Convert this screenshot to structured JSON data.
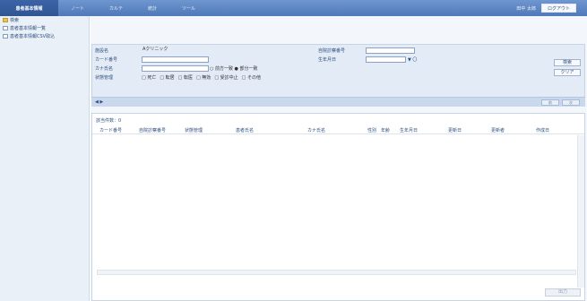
{
  "nav": {
    "tabs": [
      "患者基本情報",
      "ノート",
      "カルテ",
      "統計",
      "ツール"
    ],
    "user": "田中 太郎",
    "logout": "ログアウト"
  },
  "sidebar": {
    "items": [
      {
        "label": "検索",
        "icon": "folder-icon"
      },
      {
        "label": "患者基本情報一覧",
        "icon": "doc-icon"
      },
      {
        "label": "患者基本情報CSV取込",
        "icon": "doc-icon"
      }
    ]
  },
  "search": {
    "labels": {
      "clinic": "施設名",
      "card": "カード番号",
      "kana": "カナ氏名",
      "status": "状態管理",
      "tmp_no": "自院診察番号",
      "birth": "生年月日"
    },
    "values": {
      "clinic": "Aクリニック",
      "birth_suffix": "▼ 〇"
    },
    "radio": "○ 前方一致 ● 部分一致",
    "checkboxes": [
      "□ 死亡",
      "□ 転居",
      "□ 転医",
      "□ 無効",
      "□ 受診中止",
      "□ その他"
    ],
    "buttons": {
      "search": "検索",
      "clear": "クリア"
    },
    "pager": {
      "arrows": "◀ ▶",
      "prev": "前",
      "next": "次"
    }
  },
  "results": {
    "count_label": "該当件数：0",
    "headers": [
      "カード番号",
      "自院診察番号",
      "状態管理",
      "患者氏名",
      "カナ氏名",
      "性別",
      "年齢",
      "生年月日",
      "更新日",
      "更新者",
      "作成日"
    ],
    "output_button": "出力"
  }
}
